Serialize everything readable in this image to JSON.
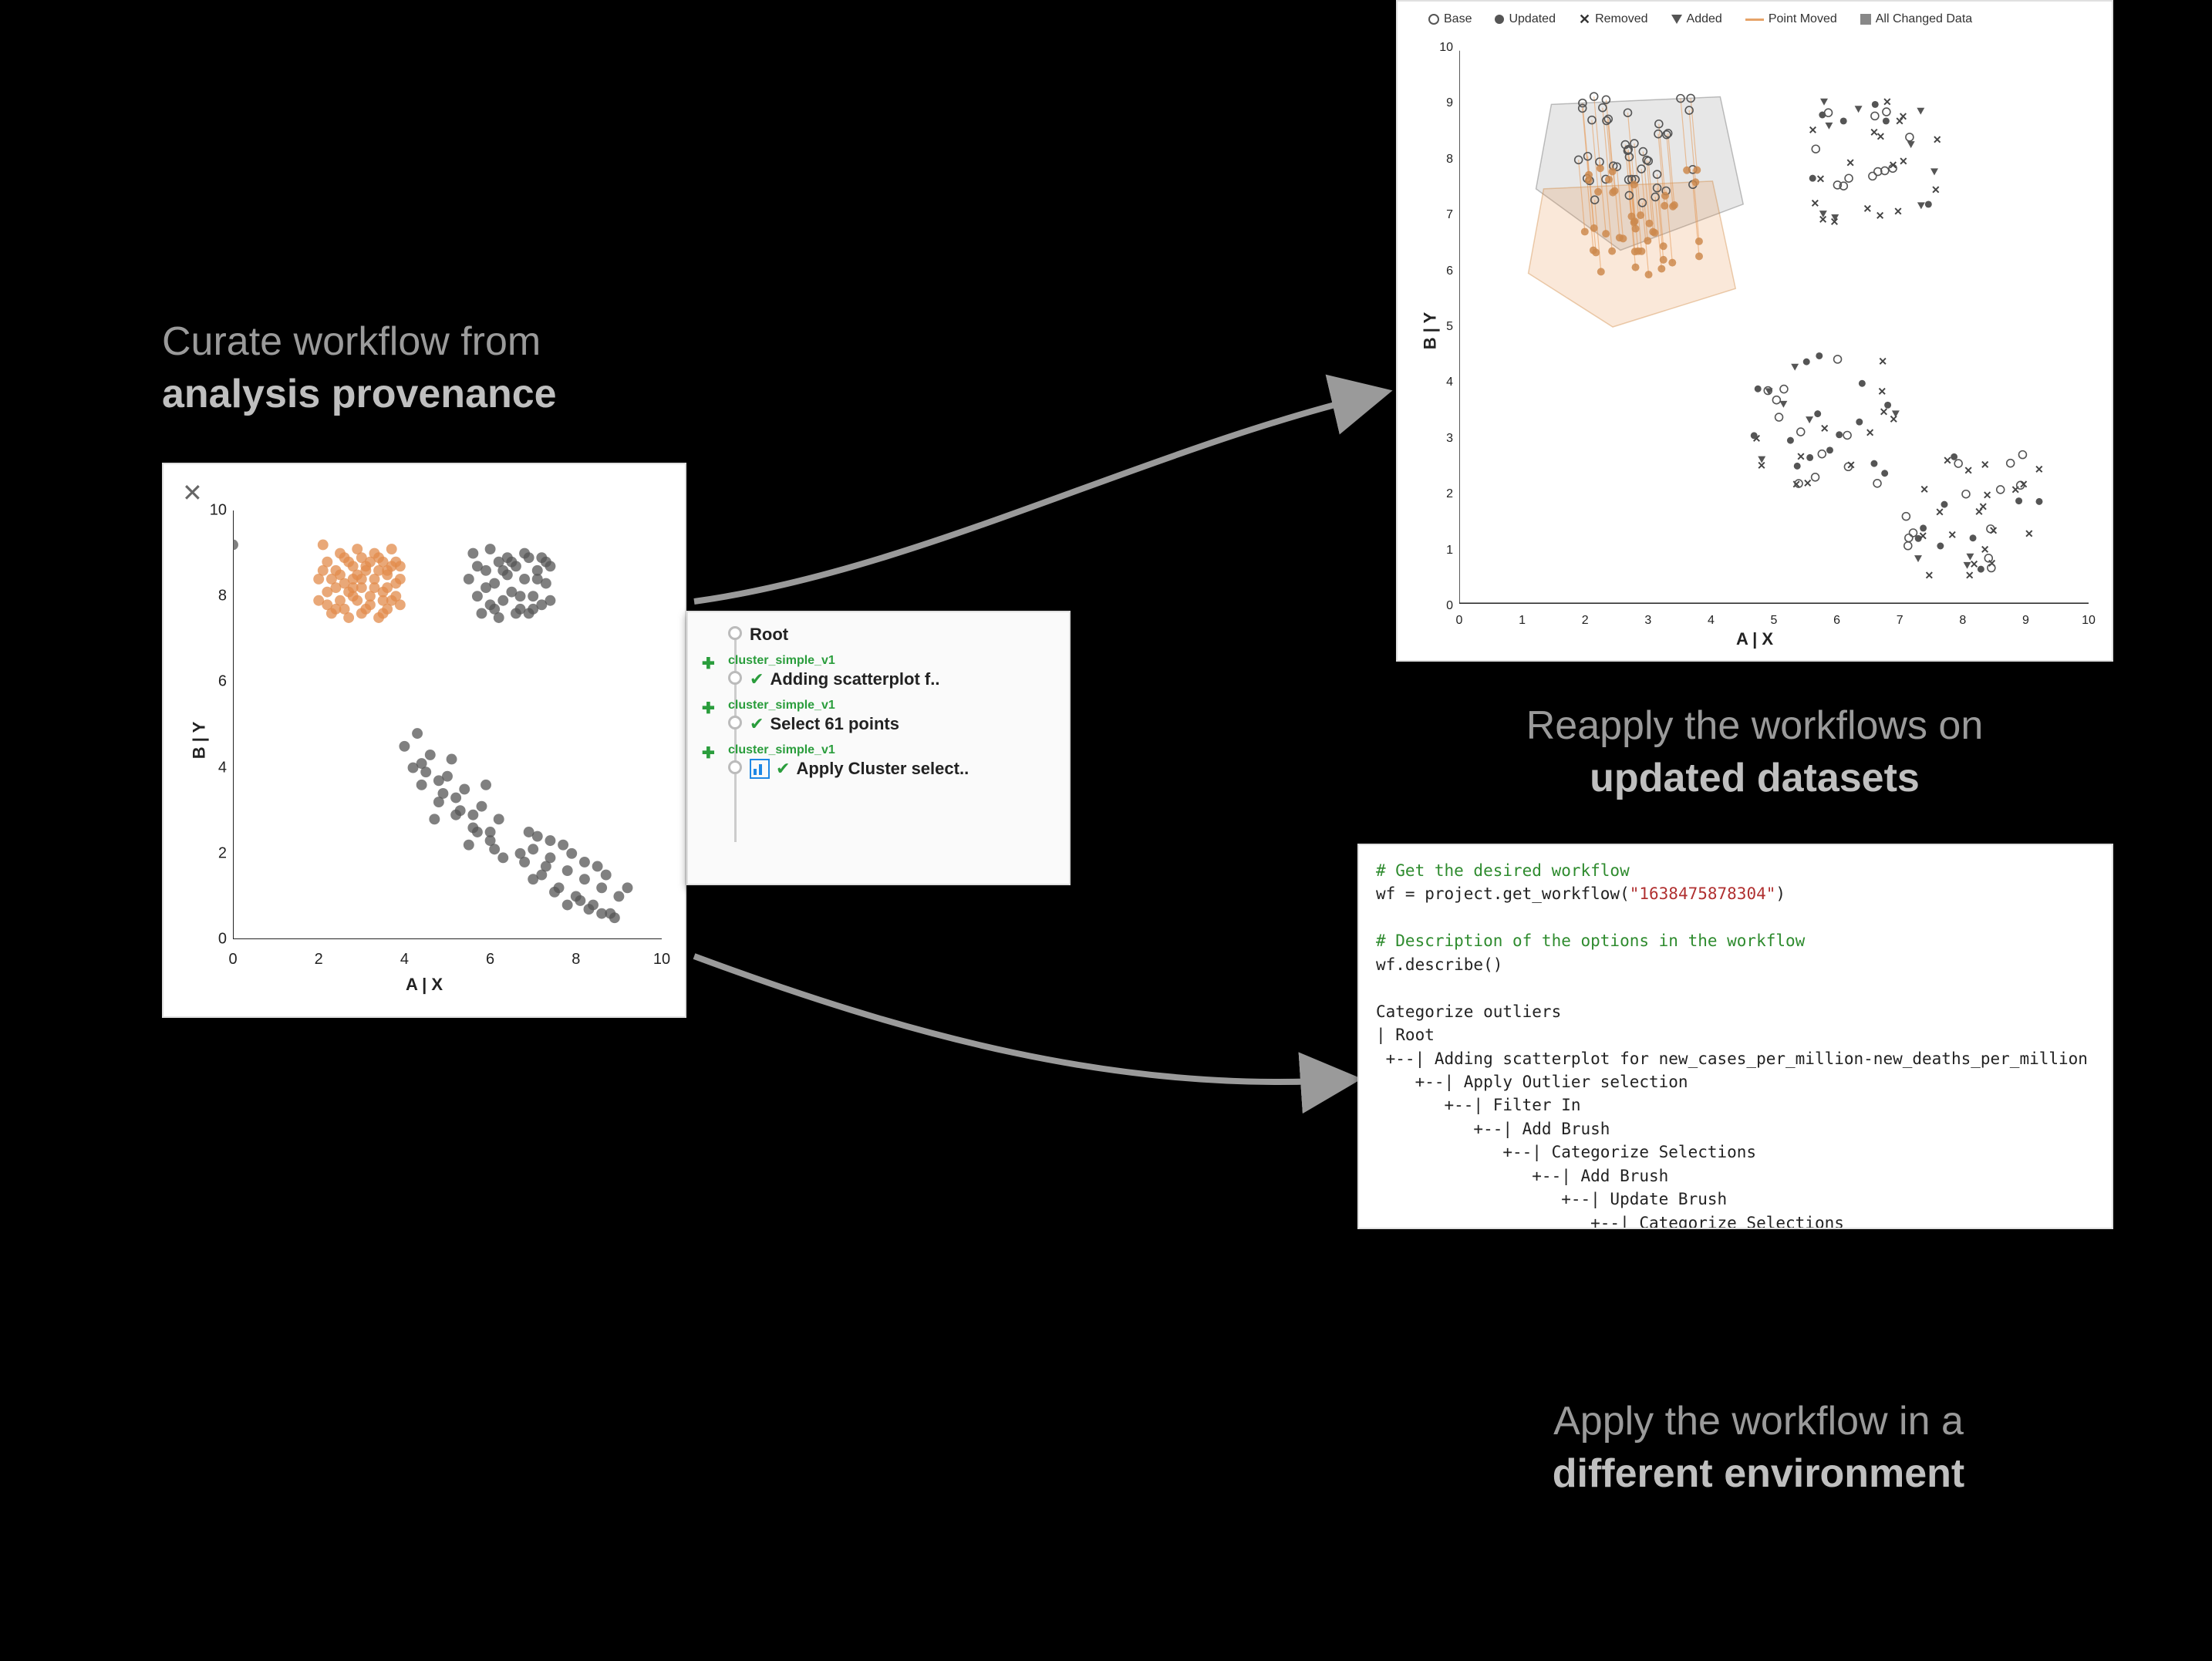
{
  "labels": {
    "curate_l1": "Curate workflow from",
    "curate_l2": "analysis provenance",
    "reapply_l1": "Reapply the workflows on",
    "reapply_l2": "updated datasets",
    "apply_l1": "Apply the workflow in a",
    "apply_l2": "different environment"
  },
  "left_scatter": {
    "x_label": "A | X",
    "y_label": "B | Y",
    "x_ticks": [
      "0",
      "2",
      "4",
      "6",
      "8",
      "10"
    ],
    "y_ticks": [
      "0",
      "2",
      "4",
      "6",
      "8",
      "10"
    ]
  },
  "right_scatter": {
    "x_label": "A | X",
    "y_label": "B | Y",
    "x_ticks": [
      "0",
      "1",
      "2",
      "3",
      "4",
      "5",
      "6",
      "7",
      "8",
      "9",
      "10"
    ],
    "y_ticks": [
      "0",
      "1",
      "2",
      "3",
      "4",
      "5",
      "6",
      "7",
      "8",
      "9",
      "10"
    ],
    "legend": {
      "base": "Base",
      "updated": "Updated",
      "removed": "Removed",
      "added": "Added",
      "point_moved": "Point Moved",
      "all_changed": "All Changed Data"
    }
  },
  "provenance": {
    "root": "Root",
    "tag": "cluster_simple_v1",
    "n1": "Adding scatterplot f..",
    "n2": "Select 61 points",
    "n3": "Apply Cluster select.."
  },
  "code": {
    "c1": "# Get the desired workflow",
    "l1a": "wf = project.get_workflow(",
    "l1s": "\"1638475878304\"",
    "l1b": ")",
    "c2": "# Description of the options in the workflow",
    "l2": "wf.describe()",
    "out": "Categorize outliers\n| Root\n +--| Adding scatterplot for new_cases_per_million-new_deaths_per_million\n    +--| Apply Outlier selection\n       +--| Filter In\n          +--| Add Brush\n             +--| Categorize Selections\n                +--| Add Brush\n                   +--| Update Brush\n                      +--| Categorize Selections\n                         +--| Add Brush\n                            +--| Categorize Selections"
  },
  "chart_data": [
    {
      "type": "scatter",
      "name": "left-source-scatter",
      "xlabel": "A | X",
      "ylabel": "B | Y",
      "xlim": [
        0,
        10
      ],
      "ylim": [
        0,
        10
      ],
      "series": [
        {
          "name": "selected",
          "color": "#e28b4b",
          "marker": "circle",
          "points": [
            [
              2.0,
              8.4
            ],
            [
              2.2,
              8.1
            ],
            [
              2.4,
              8.6
            ],
            [
              2.5,
              7.9
            ],
            [
              2.6,
              8.3
            ],
            [
              2.7,
              8.8
            ],
            [
              2.8,
              8.0
            ],
            [
              2.9,
              8.5
            ],
            [
              3.0,
              8.2
            ],
            [
              3.1,
              8.7
            ],
            [
              3.2,
              7.8
            ],
            [
              3.3,
              8.4
            ],
            [
              3.4,
              8.9
            ],
            [
              3.5,
              8.1
            ],
            [
              3.6,
              8.6
            ],
            [
              3.7,
              7.9
            ],
            [
              3.8,
              8.3
            ],
            [
              3.9,
              8.7
            ],
            [
              2.1,
              9.2
            ],
            [
              2.3,
              7.6
            ],
            [
              2.5,
              9.0
            ],
            [
              2.7,
              7.5
            ],
            [
              2.9,
              9.1
            ],
            [
              3.1,
              7.7
            ],
            [
              3.3,
              9.0
            ],
            [
              3.5,
              7.6
            ],
            [
              3.7,
              9.1
            ],
            [
              3.9,
              7.8
            ],
            [
              2.2,
              8.8
            ],
            [
              2.6,
              7.7
            ],
            [
              3.0,
              8.9
            ],
            [
              3.4,
              7.5
            ],
            [
              3.8,
              8.8
            ],
            [
              2.4,
              8.2
            ],
            [
              2.8,
              8.7
            ],
            [
              3.2,
              8.0
            ],
            [
              3.6,
              8.5
            ],
            [
              2.0,
              7.9
            ],
            [
              2.5,
              8.5
            ],
            [
              3.0,
              7.6
            ],
            [
              3.5,
              8.8
            ],
            [
              2.3,
              8.4
            ],
            [
              2.7,
              8.1
            ],
            [
              3.1,
              8.6
            ],
            [
              3.5,
              7.9
            ],
            [
              3.9,
              8.4
            ],
            [
              2.1,
              8.6
            ],
            [
              2.9,
              7.9
            ],
            [
              3.3,
              8.2
            ],
            [
              3.7,
              8.7
            ],
            [
              2.4,
              7.7
            ],
            [
              2.8,
              8.4
            ],
            [
              3.2,
              8.8
            ],
            [
              3.6,
              7.7
            ],
            [
              2.6,
              8.9
            ],
            [
              3.0,
              8.4
            ],
            [
              3.4,
              8.6
            ],
            [
              3.8,
              8.0
            ],
            [
              2.2,
              7.8
            ],
            [
              3.6,
              8.2
            ],
            [
              2.8,
              8.2
            ]
          ]
        },
        {
          "name": "unselected",
          "color": "#555",
          "marker": "circle",
          "points": [
            [
              5.5,
              8.4
            ],
            [
              5.7,
              8.0
            ],
            [
              5.9,
              8.6
            ],
            [
              6.0,
              7.8
            ],
            [
              6.1,
              8.3
            ],
            [
              6.2,
              8.8
            ],
            [
              6.3,
              7.9
            ],
            [
              6.4,
              8.5
            ],
            [
              6.5,
              8.1
            ],
            [
              6.6,
              8.7
            ],
            [
              6.7,
              7.7
            ],
            [
              6.8,
              8.4
            ],
            [
              6.9,
              8.9
            ],
            [
              7.0,
              8.0
            ],
            [
              7.1,
              8.6
            ],
            [
              7.2,
              7.8
            ],
            [
              7.3,
              8.3
            ],
            [
              7.4,
              8.7
            ],
            [
              5.6,
              9.0
            ],
            [
              5.8,
              7.6
            ],
            [
              6.0,
              9.1
            ],
            [
              6.2,
              7.5
            ],
            [
              6.4,
              8.9
            ],
            [
              6.6,
              7.6
            ],
            [
              6.8,
              9.0
            ],
            [
              7.0,
              7.7
            ],
            [
              7.2,
              8.9
            ],
            [
              7.4,
              7.9
            ],
            [
              5.7,
              8.7
            ],
            [
              6.1,
              7.7
            ],
            [
              6.5,
              8.8
            ],
            [
              6.9,
              7.6
            ],
            [
              7.3,
              8.8
            ],
            [
              5.9,
              8.2
            ],
            [
              6.3,
              8.6
            ],
            [
              6.7,
              8.0
            ],
            [
              7.1,
              8.4
            ],
            [
              4.2,
              4.0
            ],
            [
              4.4,
              3.6
            ],
            [
              4.6,
              4.3
            ],
            [
              4.8,
              3.2
            ],
            [
              5.0,
              3.8
            ],
            [
              5.2,
              2.9
            ],
            [
              5.4,
              3.5
            ],
            [
              5.6,
              2.6
            ],
            [
              5.8,
              3.1
            ],
            [
              6.0,
              2.3
            ],
            [
              6.2,
              2.8
            ],
            [
              4.3,
              4.8
            ],
            [
              4.7,
              2.8
            ],
            [
              5.1,
              4.2
            ],
            [
              5.5,
              2.2
            ],
            [
              5.9,
              3.6
            ],
            [
              6.3,
              1.9
            ],
            [
              4.5,
              3.9
            ],
            [
              4.9,
              3.4
            ],
            [
              5.3,
              3.0
            ],
            [
              5.7,
              2.5
            ],
            [
              6.1,
              2.1
            ],
            [
              4.0,
              4.5
            ],
            [
              4.4,
              4.1
            ],
            [
              4.8,
              3.7
            ],
            [
              5.2,
              3.3
            ],
            [
              5.6,
              2.9
            ],
            [
              6.0,
              2.5
            ],
            [
              6.8,
              1.8
            ],
            [
              7.0,
              2.1
            ],
            [
              7.2,
              1.5
            ],
            [
              7.4,
              1.9
            ],
            [
              7.6,
              1.2
            ],
            [
              7.8,
              1.6
            ],
            [
              8.0,
              1.0
            ],
            [
              8.2,
              1.4
            ],
            [
              8.4,
              0.8
            ],
            [
              8.6,
              1.2
            ],
            [
              8.8,
              0.6
            ],
            [
              9.0,
              1.0
            ],
            [
              7.1,
              2.4
            ],
            [
              7.5,
              1.1
            ],
            [
              7.9,
              2.0
            ],
            [
              8.3,
              0.7
            ],
            [
              8.7,
              1.5
            ],
            [
              6.9,
              2.5
            ],
            [
              7.3,
              1.7
            ],
            [
              7.7,
              2.2
            ],
            [
              8.1,
              0.9
            ],
            [
              8.5,
              1.7
            ],
            [
              8.9,
              0.5
            ],
            [
              7.0,
              1.4
            ],
            [
              7.4,
              2.3
            ],
            [
              7.8,
              0.8
            ],
            [
              8.2,
              1.8
            ],
            [
              8.6,
              0.6
            ],
            [
              6.7,
              2.0
            ],
            [
              9.2,
              1.2
            ],
            [
              0.0,
              9.2
            ]
          ]
        }
      ]
    },
    {
      "type": "scatter",
      "name": "right-comparison-scatter",
      "xlabel": "A | X",
      "ylabel": "B | Y",
      "xlim": [
        0,
        10
      ],
      "ylim": [
        0,
        10
      ],
      "legend_position": "top",
      "annotations": [
        "Semi-transparent convex hulls over the top-left cluster show its position before (upper, gray) and after (lower, orange-tinted) the update; thin orange lines connect moved points."
      ],
      "series": [
        {
          "name": "Base",
          "marker": "open-circle",
          "points": "dense 4-cluster layout matching left chart"
        },
        {
          "name": "Updated",
          "marker": "filled-circle",
          "points": "slightly shifted positions of Base"
        },
        {
          "name": "Removed",
          "marker": "x",
          "points": "subset of Base no longer present"
        },
        {
          "name": "Added",
          "marker": "triangle-down",
          "points": "new points in updated dataset"
        },
        {
          "name": "Point Moved",
          "marker": "orange-line",
          "points": "segments linking old→new position for top-left cluster"
        }
      ]
    }
  ]
}
